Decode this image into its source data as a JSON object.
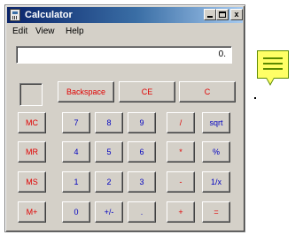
{
  "window": {
    "title": "Calculator",
    "close_glyph": "x"
  },
  "menu": {
    "edit": "Edit",
    "view": "View",
    "help": "Help"
  },
  "display": {
    "value": "0."
  },
  "top_buttons": {
    "backspace": "Backspace",
    "ce": "CE",
    "c": "C"
  },
  "memory_buttons": {
    "mc": "MC",
    "mr": "MR",
    "ms": "MS",
    "mplus": "M+"
  },
  "keys": {
    "row1": [
      "7",
      "8",
      "9",
      "/",
      "sqrt"
    ],
    "row2": [
      "4",
      "5",
      "6",
      "*",
      "%"
    ],
    "row3": [
      "1",
      "2",
      "3",
      "-",
      "1/x"
    ],
    "row4": [
      "0",
      "+/-",
      ".",
      "+",
      "="
    ]
  },
  "side_note": {
    "icon": "sticky-note-icon",
    "color": "#ffff66"
  }
}
